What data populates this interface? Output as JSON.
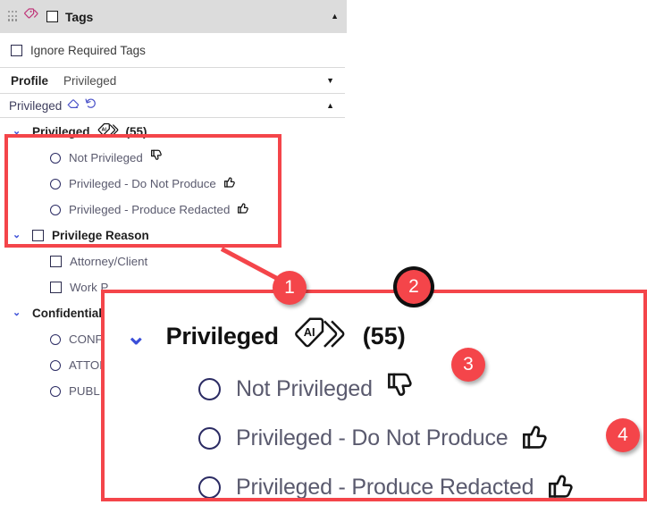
{
  "header": {
    "title": "Tags",
    "drag_handle_icon": "grid-drag-handle-icon",
    "tag_icon": "tag-icon",
    "checkbox_icon": "checkbox-icon",
    "collapse_icon": "caret-up-icon",
    "collapse_glyph": "▲"
  },
  "ignore_row": {
    "label": "Ignore Required Tags",
    "checkbox_icon": "checkbox-icon"
  },
  "profile_row": {
    "key": "Profile",
    "value": "Privileged",
    "dropdown_icon": "caret-down-icon",
    "dropdown_glyph": "▼"
  },
  "privileged_row": {
    "label": "Privileged",
    "eraser_icon": "eraser-icon",
    "undo_icon": "undo-arrow-icon",
    "collapse_icon": "caret-up-icon",
    "collapse_glyph": "▲"
  },
  "tree": {
    "chevron_glyph": "⌄",
    "groups": [
      {
        "label": "Privileged",
        "count": "(55)",
        "ai_icon": "ai-tag-icon",
        "has_checkbox": false,
        "items": [
          {
            "label": "Not Privileged",
            "control": "radio",
            "icon": "thumbs-down-icon"
          },
          {
            "label": "Privileged - Do Not Produce",
            "control": "radio",
            "icon": "thumbs-up-icon"
          },
          {
            "label": "Privileged - Produce Redacted",
            "control": "radio",
            "icon": "thumbs-up-icon"
          }
        ]
      },
      {
        "label": "Privilege Reason",
        "count": "",
        "has_checkbox": true,
        "items": [
          {
            "label": "Attorney/Client",
            "control": "checkbox",
            "icon": ""
          },
          {
            "label": "Work P",
            "control": "checkbox",
            "icon": ""
          }
        ]
      },
      {
        "label": "Confidential",
        "count": "",
        "has_checkbox": false,
        "items": [
          {
            "label": "CONFI",
            "control": "radio",
            "icon": ""
          },
          {
            "label": "ATTOR",
            "control": "radio",
            "icon": ""
          },
          {
            "label": "PUBLI",
            "control": "radio",
            "icon": ""
          }
        ]
      }
    ]
  },
  "zoom_callout": {
    "chevron_glyph": "⌄",
    "title": "Privileged",
    "count": "(55)",
    "ai_icon": "ai-tag-icon",
    "items": [
      {
        "label": "Not Privileged",
        "icon": "thumbs-down-icon"
      },
      {
        "label": "Privileged - Do Not Produce",
        "icon": "thumbs-up-icon"
      },
      {
        "label": "Privileged - Produce Redacted",
        "icon": "thumbs-up-icon"
      }
    ]
  },
  "badges": [
    {
      "number": "1",
      "ring": false
    },
    {
      "number": "2",
      "ring": true
    },
    {
      "number": "3",
      "ring": false
    },
    {
      "number": "4",
      "ring": false
    }
  ],
  "colors": {
    "accent_red": "#f4454a",
    "header_gray": "#dcdcdc",
    "chevron_blue": "#3b4fd8",
    "tag_pink": "#c0377a",
    "label_gray": "#5a5a6e",
    "radio_navy": "#2b2b63"
  }
}
